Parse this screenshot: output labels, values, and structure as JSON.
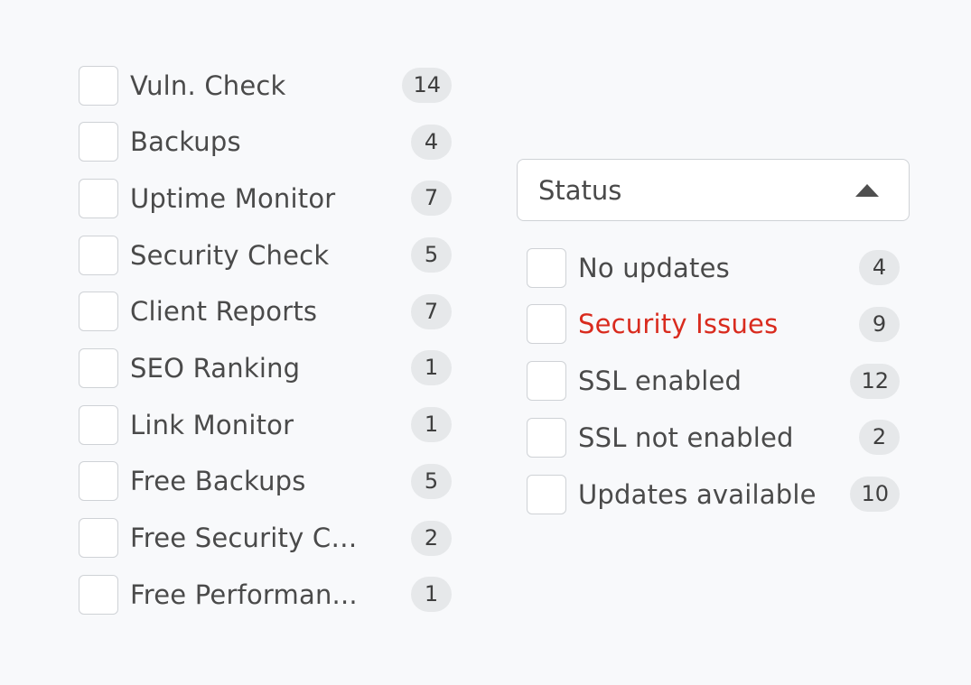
{
  "left_filters": [
    {
      "label": "Vuln. Check",
      "count": "14"
    },
    {
      "label": "Backups",
      "count": "4"
    },
    {
      "label": "Uptime Monitor",
      "count": "7"
    },
    {
      "label": "Security Check",
      "count": "5"
    },
    {
      "label": "Client Reports",
      "count": "7"
    },
    {
      "label": "SEO Ranking",
      "count": "1"
    },
    {
      "label": "Link Monitor",
      "count": "1"
    },
    {
      "label": "Free Backups",
      "count": "5"
    },
    {
      "label": "Free Security Ch...",
      "count": "2"
    },
    {
      "label": "Free Performan...",
      "count": "1"
    }
  ],
  "status_dropdown": {
    "label": "Status",
    "icon": "caret-up-icon"
  },
  "status_filters": [
    {
      "label": "No updates",
      "count": "4"
    },
    {
      "label": "Security Issues",
      "count": "9",
      "color": "#d92b1e"
    },
    {
      "label": "SSL enabled",
      "count": "12"
    },
    {
      "label": "SSL not enabled",
      "count": "2"
    },
    {
      "label": "Updates available",
      "count": "10"
    }
  ],
  "colors": {
    "background": "#f8f9fb",
    "text": "#4a4a4a",
    "danger": "#d92b1e",
    "badge": "#e6e8ea",
    "border": "#cfd2d6"
  }
}
